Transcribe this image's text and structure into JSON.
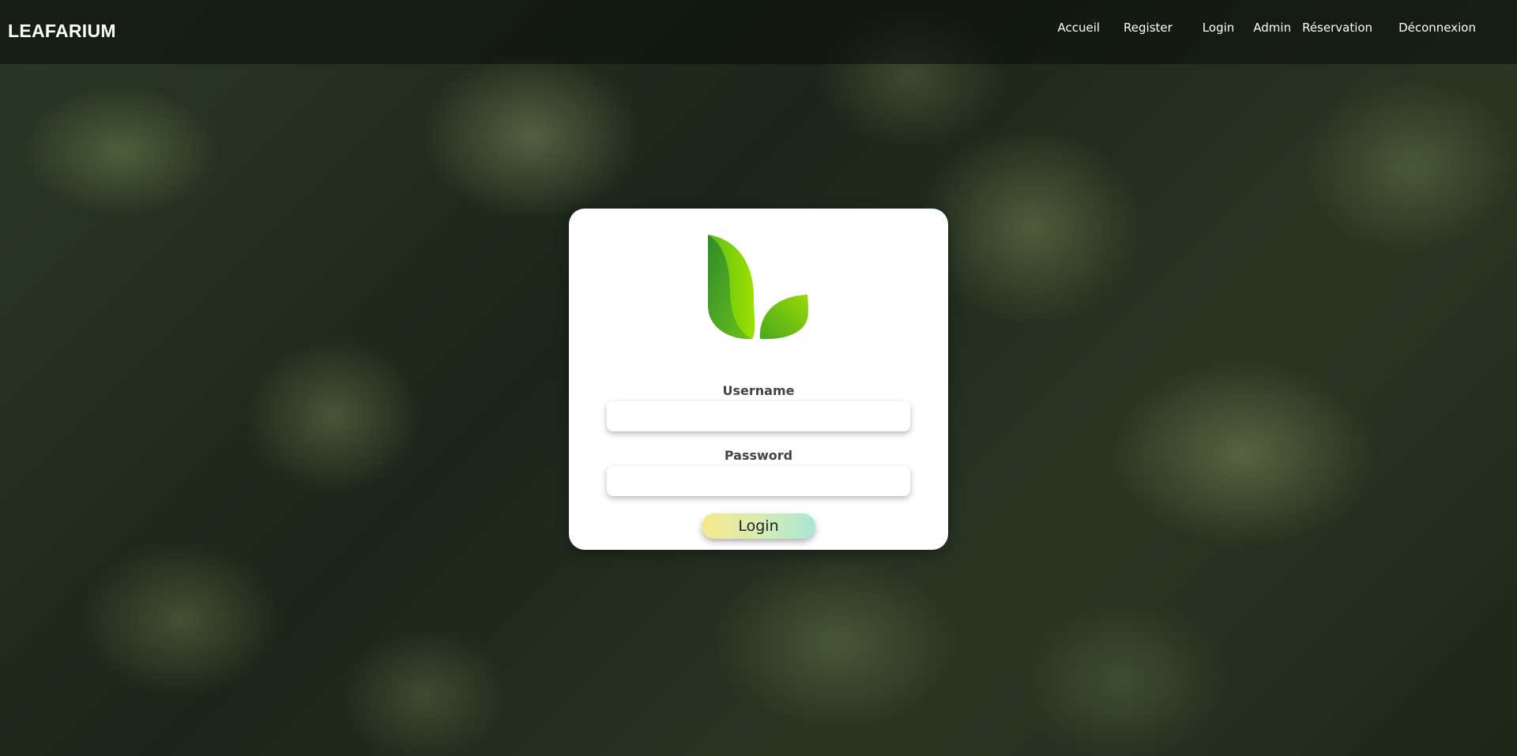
{
  "navbar": {
    "brand": "LEAFARIUM",
    "links": [
      "Accueil",
      "Register",
      "Login",
      "Admin",
      "Réservation",
      "Déconnexion"
    ]
  },
  "login_form": {
    "logo_icon": "leaf-logo-icon",
    "username_label": "Username",
    "username_value": "",
    "password_label": "Password",
    "password_value": "",
    "submit_label": "Login"
  },
  "colors": {
    "brand_green_dark": "#3f9b1e",
    "brand_green_light": "#8fd400",
    "button_gradient_start": "#f6e88c",
    "button_gradient_end": "#a9e6d8"
  }
}
